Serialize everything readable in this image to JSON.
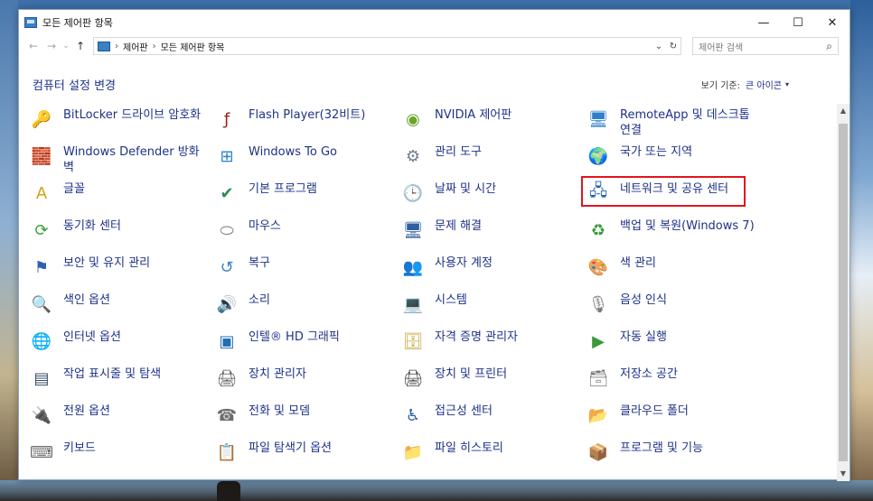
{
  "window": {
    "title": "모든 제어판 항목",
    "buttons": {
      "minimize": "—",
      "maximize": "☐",
      "close": "✕"
    }
  },
  "address": {
    "back": "←",
    "forward": "→",
    "recent": "⌄",
    "up": "↑",
    "crumbs": [
      "제어판",
      "모든 제어판 항목"
    ],
    "dropdown": "⌄",
    "refresh": "↻"
  },
  "search": {
    "placeholder": "제어판 검색",
    "icon": "⌕"
  },
  "header": {
    "title": "컴퓨터 설정 변경",
    "view_by_label": "보기 기준:",
    "view_by_value": "큰 아이콘",
    "caret": "▾"
  },
  "items": [
    [
      {
        "label": "BitLocker 드라이브 암호화",
        "icon": "key-lock-icon",
        "glyph": "🔑",
        "color": "#b48b2a"
      },
      {
        "label": "Windows Defender 방화벽",
        "icon": "firewall-icon",
        "glyph": "🧱",
        "color": "#a4452a"
      },
      {
        "label": "글꼴",
        "icon": "fonts-icon",
        "glyph": "A",
        "color": "#d4a017"
      },
      {
        "label": "동기화 센터",
        "icon": "sync-center-icon",
        "glyph": "⟳",
        "color": "#3aa13a"
      },
      {
        "label": "보안 및 유지 관리",
        "icon": "flag-icon",
        "glyph": "⚑",
        "color": "#2d5fb5"
      },
      {
        "label": "색인 옵션",
        "icon": "magnifier-icon",
        "glyph": "🔍",
        "color": "#5a7ba8"
      },
      {
        "label": "인터넷 옵션",
        "icon": "globe-icon",
        "glyph": "🌐",
        "color": "#2f7fc9"
      },
      {
        "label": "작업 표시줄 및 탐색",
        "icon": "taskbar-icon",
        "glyph": "▤",
        "color": "#3b4f6a"
      },
      {
        "label": "전원 옵션",
        "icon": "power-icon",
        "glyph": "🔌",
        "color": "#3a8f3a"
      },
      {
        "label": "키보드",
        "icon": "keyboard-icon",
        "glyph": "⌨",
        "color": "#6d6d6d"
      }
    ],
    [
      {
        "label": "Flash Player(32비트)",
        "icon": "flash-icon",
        "glyph": "ƒ",
        "color": "#9c1c14"
      },
      {
        "label": "Windows To Go",
        "icon": "windows-to-go-icon",
        "glyph": "⊞",
        "color": "#2f7fc9"
      },
      {
        "label": "기본 프로그램",
        "icon": "default-programs-icon",
        "glyph": "✔",
        "color": "#2e8b57"
      },
      {
        "label": "마우스",
        "icon": "mouse-icon",
        "glyph": "⬭",
        "color": "#7a7a7a"
      },
      {
        "label": "복구",
        "icon": "recovery-icon",
        "glyph": "↺",
        "color": "#3b86c8"
      },
      {
        "label": "소리",
        "icon": "speaker-icon",
        "glyph": "🔊",
        "color": "#8a8a8a"
      },
      {
        "label": "인텔® HD 그래픽",
        "icon": "intel-graphics-icon",
        "glyph": "▣",
        "color": "#1f6fb5"
      },
      {
        "label": "장치 관리자",
        "icon": "device-manager-icon",
        "glyph": "🖨",
        "color": "#555555"
      },
      {
        "label": "전화 및 모뎀",
        "icon": "phone-modem-icon",
        "glyph": "☎",
        "color": "#6d6d6d"
      },
      {
        "label": "파일 탐색기 옵션",
        "icon": "folder-options-icon",
        "glyph": "📋",
        "color": "#c9a43a"
      }
    ],
    [
      {
        "label": "NVIDIA 제어판",
        "icon": "nvidia-icon",
        "glyph": "◉",
        "color": "#6aa62a"
      },
      {
        "label": "관리 도구",
        "icon": "admin-tools-icon",
        "glyph": "⚙",
        "color": "#6d7c8d"
      },
      {
        "label": "날짜 및 시간",
        "icon": "clock-icon",
        "glyph": "🕒",
        "color": "#2f7fc9"
      },
      {
        "label": "문제 해결",
        "icon": "troubleshoot-icon",
        "glyph": "🖥",
        "color": "#2f5f9f"
      },
      {
        "label": "사용자 계정",
        "icon": "users-icon",
        "glyph": "👥",
        "color": "#4a8a3a"
      },
      {
        "label": "시스템",
        "icon": "system-icon",
        "glyph": "💻",
        "color": "#2f7fc9"
      },
      {
        "label": "자격 증명 관리자",
        "icon": "credential-icon",
        "glyph": "🗄",
        "color": "#c9a43a"
      },
      {
        "label": "장치 및 프린터",
        "icon": "printer-icon",
        "glyph": "🖨",
        "color": "#444444"
      },
      {
        "label": "접근성 센터",
        "icon": "accessibility-icon",
        "glyph": "♿",
        "color": "#2a5fa8"
      },
      {
        "label": "파일 히스토리",
        "icon": "file-history-icon",
        "glyph": "📁",
        "color": "#d8a23a"
      }
    ],
    [
      {
        "label": "RemoteApp 및 데스크톱 연결",
        "icon": "remoteapp-icon",
        "glyph": "🖥",
        "color": "#2f7fc9"
      },
      {
        "label": "국가 또는 지역",
        "icon": "region-icon",
        "glyph": "🌍",
        "color": "#2f7fc9"
      },
      {
        "label": "네트워크 및 공유 센터",
        "icon": "network-icon",
        "glyph": "🖧",
        "color": "#1f5fb0"
      },
      {
        "label": "백업 및 복원(Windows 7)",
        "icon": "backup-icon",
        "glyph": "♻",
        "color": "#3a9a3a"
      },
      {
        "label": "색 관리",
        "icon": "color-management-icon",
        "glyph": "🎨",
        "color": "#d14a2a"
      },
      {
        "label": "음성 인식",
        "icon": "microphone-icon",
        "glyph": "🎙",
        "color": "#7a7a7a"
      },
      {
        "label": "자동 실행",
        "icon": "autoplay-icon",
        "glyph": "▶",
        "color": "#3a9a3a"
      },
      {
        "label": "저장소 공간",
        "icon": "storage-icon",
        "glyph": "🗃",
        "color": "#7a7a7a"
      },
      {
        "label": "클라우드 폴더",
        "icon": "cloud-folder-icon",
        "glyph": "📂",
        "color": "#3a7fd0"
      },
      {
        "label": "프로그램 및 기능",
        "icon": "programs-features-icon",
        "glyph": "📦",
        "color": "#5a5a5a"
      }
    ]
  ],
  "highlight_item": "네트워크 및 공유 센터",
  "accent_color": "#1e3287",
  "highlight_color": "#e2141e"
}
